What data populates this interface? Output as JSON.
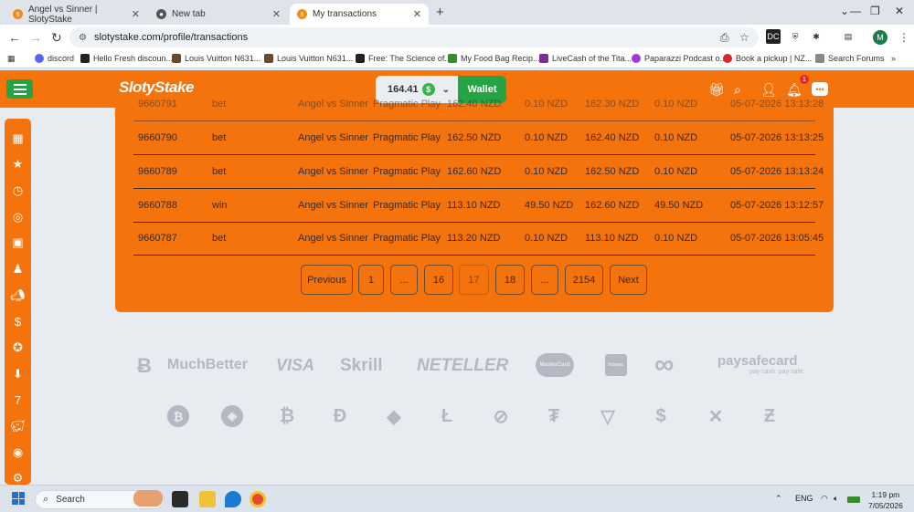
{
  "browser": {
    "tabs": [
      {
        "title": "Angel vs Sinner | SlotyStake",
        "active": false
      },
      {
        "title": "New tab",
        "active": false
      },
      {
        "title": "My transactions",
        "active": true
      }
    ],
    "url": "slotystake.com/profile/transactions",
    "bookmarks": [
      "discord",
      "Hello Fresh discoun...",
      "Louis Vuitton N631...",
      "Louis Vuitton N631...",
      "Free: The Science of...",
      "My Food Bag Recip...",
      "LiveCash of the Tita...",
      "Paparazzi Podcast o...",
      "Book a pickup | NZ...",
      "Search Forums"
    ],
    "avatar_letter": "M"
  },
  "header": {
    "logo": "SlotyStake",
    "balance": "164.41",
    "coin_symbol": "$",
    "wallet_label": "Wallet",
    "notification_count": "1"
  },
  "transactions": {
    "partial_row": [
      "9660791",
      "bet",
      "Angel vs Sinner",
      "Pragmatic Play",
      "162.40 NZD",
      "0.10 NZD",
      "162.30 NZD",
      "0.10 NZD",
      "05-07-2026 13:13:28"
    ],
    "rows": [
      {
        "id": "9660790",
        "type": "bet",
        "game": "Angel vs Sinner",
        "provider": "Pragmatic Play",
        "balance_before": "162.50 NZD",
        "amount": "0.10 NZD",
        "balance_after": "162.40 NZD",
        "real": "0.10 NZD",
        "date": "05-07-2026 13:13:25"
      },
      {
        "id": "9660789",
        "type": "bet",
        "game": "Angel vs Sinner",
        "provider": "Pragmatic Play",
        "balance_before": "162.60 NZD",
        "amount": "0.10 NZD",
        "balance_after": "162.50 NZD",
        "real": "0.10 NZD",
        "date": "05-07-2026 13:13:24"
      },
      {
        "id": "9660788",
        "type": "win",
        "game": "Angel vs Sinner",
        "provider": "Pragmatic Play",
        "balance_before": "113.10 NZD",
        "amount": "49.50 NZD",
        "balance_after": "162.60 NZD",
        "real": "49.50 NZD",
        "date": "05-07-2026 13:12:57"
      },
      {
        "id": "9660787",
        "type": "bet",
        "game": "Angel vs Sinner",
        "provider": "Pragmatic Play",
        "balance_before": "113.20 NZD",
        "amount": "0.10 NZD",
        "balance_after": "113.10 NZD",
        "real": "0.10 NZD",
        "date": "05-07-2026 13:05:45"
      }
    ]
  },
  "pagination": {
    "previous": "Previous",
    "p1": "1",
    "ellipsis": "...",
    "p16": "16",
    "p17": "17",
    "p18": "18",
    "last": "2154",
    "next": "Next",
    "current": "17"
  },
  "payments": {
    "muchbetter": "MuchBetter",
    "visa": "VISA",
    "skrill": "Skrill",
    "neteller": "NETELLER",
    "mastercard": "MasterCard",
    "interac": "Interac",
    "paysafecard": "paysafecard",
    "paysafe_tag": "pay cash. pay safe."
  },
  "taskbar": {
    "search_label": "Search",
    "lang": "ENG",
    "time": "1:19 pm",
    "date": "7/05/2026"
  },
  "colors": {
    "brand_orange": "#f5730c",
    "brand_green": "#26a345",
    "page_bg": "#e8ebf0"
  }
}
